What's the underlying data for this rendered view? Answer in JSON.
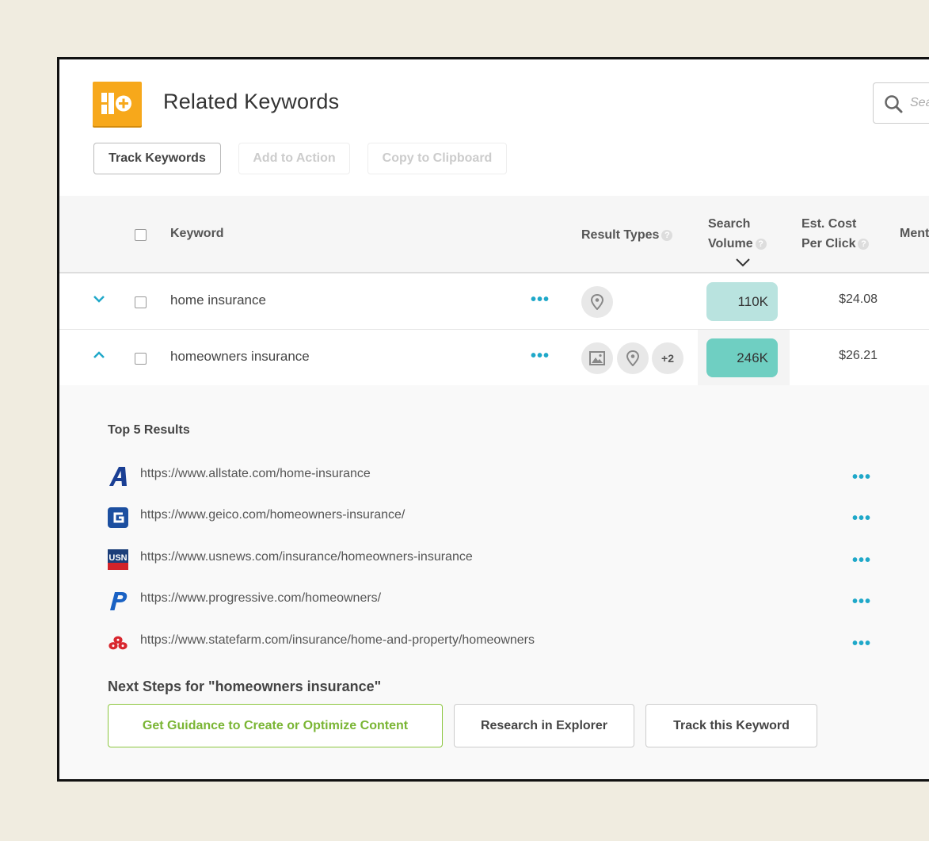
{
  "header": {
    "title": "Related Keywords",
    "search_placeholder": "Search"
  },
  "toolbar": {
    "track": "Track Keywords",
    "add_action": "Add to Action",
    "copy": "Copy to Clipboard"
  },
  "table": {
    "columns": {
      "keyword": "Keyword",
      "result_types": "Result Types",
      "search_volume_1": "Search",
      "search_volume_2": "Volume",
      "cpc_1": "Est. Cost",
      "cpc_2": "Per Click",
      "mentions": "Ment"
    },
    "rows": [
      {
        "keyword": "home insurance",
        "result_types": [
          "location-pin-icon"
        ],
        "volume": "110K",
        "cpc": "$24.08",
        "expanded": false
      },
      {
        "keyword": "homeowners insurance",
        "result_types": [
          "image-icon",
          "location-pin-icon"
        ],
        "more_types": "+2",
        "volume": "246K",
        "cpc": "$26.21",
        "expanded": true
      }
    ]
  },
  "expanded": {
    "heading": "Top 5 Results",
    "results": [
      {
        "url": "https://www.allstate.com/home-insurance",
        "icon": "allstate-logo-icon"
      },
      {
        "url": "https://www.geico.com/homeowners-insurance/",
        "icon": "geico-logo-icon"
      },
      {
        "url": "https://www.usnews.com/insurance/homeowners-insurance",
        "icon": "usnews-logo-icon"
      },
      {
        "url": "https://www.progressive.com/homeowners/",
        "icon": "progressive-logo-icon"
      },
      {
        "url": "https://www.statefarm.com/insurance/home-and-property/homeowners",
        "icon": "statefarm-logo-icon"
      }
    ],
    "next_steps_title": "Next Steps for \"homeowners insurance\"",
    "buttons": {
      "guidance": "Get Guidance to Create or Optimize Content",
      "research": "Research in Explorer",
      "track": "Track this Keyword"
    }
  },
  "colors": {
    "accent_teal": "#1fa8c9",
    "volume_light": "#b9e3df",
    "volume_dark": "#6fcfc2",
    "logo_orange": "#f7a81b",
    "guidance_green": "#7ab534"
  }
}
